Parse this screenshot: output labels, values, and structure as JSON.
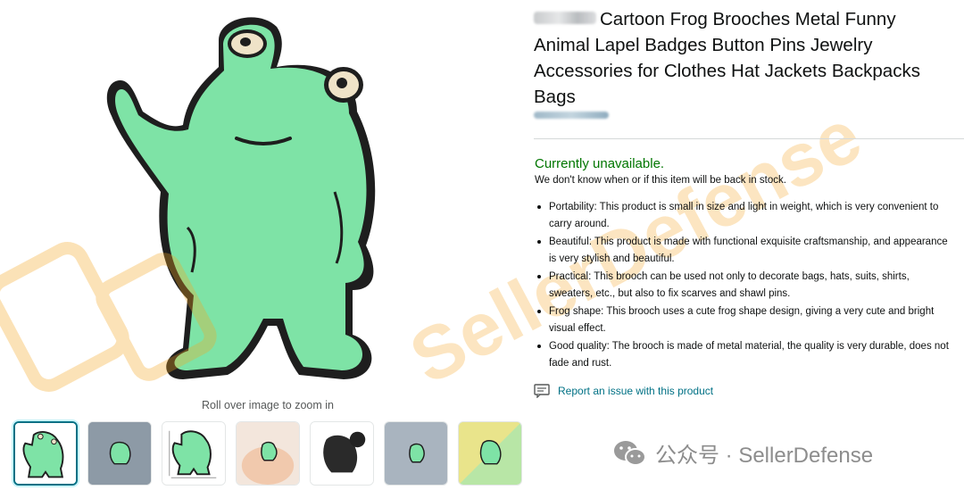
{
  "product": {
    "title": "Cartoon Frog Brooches Metal Funny Animal Lapel Badges Button Pins Jewelry Accessories for Clothes Hat Jackets Backpacks Bags",
    "availability": "Currently unavailable.",
    "stock_note": "We don't know when or if this item will be back in stock.",
    "bullets": [
      "Portability: This product is small in size and light in weight, which is very convenient to carry around.",
      "Beautiful: This product is made with functional exquisite craftsmanship, and appearance is very stylish and beautiful.",
      "Practical: This brooch can be used not only to decorate bags, hats, suits, shirts, sweaters, etc., but also to fix scarves and shawl pins.",
      "Frog shape: This brooch uses a cute frog shape design, giving a very cute and bright visual effect.",
      "Good quality: The brooch is made of metal material, the quality is very durable, does not fade and rust."
    ]
  },
  "gallery": {
    "zoom_hint": "Roll over image to zoom in",
    "thumbnails": [
      {
        "alt": "frog pin front",
        "selected": true
      },
      {
        "alt": "frog pin on denim",
        "selected": false
      },
      {
        "alt": "frog pin with size",
        "selected": false
      },
      {
        "alt": "frog pin in hand",
        "selected": false
      },
      {
        "alt": "frog pin back",
        "selected": false
      },
      {
        "alt": "frog pin on jacket",
        "selected": false
      },
      {
        "alt": "frog pin on green",
        "selected": false
      }
    ]
  },
  "report": {
    "label": "Report an issue with this product",
    "icon": "report-icon"
  },
  "watermark": {
    "text": "SellerDefense",
    "footer_text": "公众号 · SellerDefense",
    "icon": "wechat-icon"
  },
  "colors": {
    "frog_green": "#7ee3a6",
    "outline": "#1f1f1f",
    "availability_green": "#007600",
    "link_teal": "#007185",
    "watermark_orange": "#f5a623"
  }
}
